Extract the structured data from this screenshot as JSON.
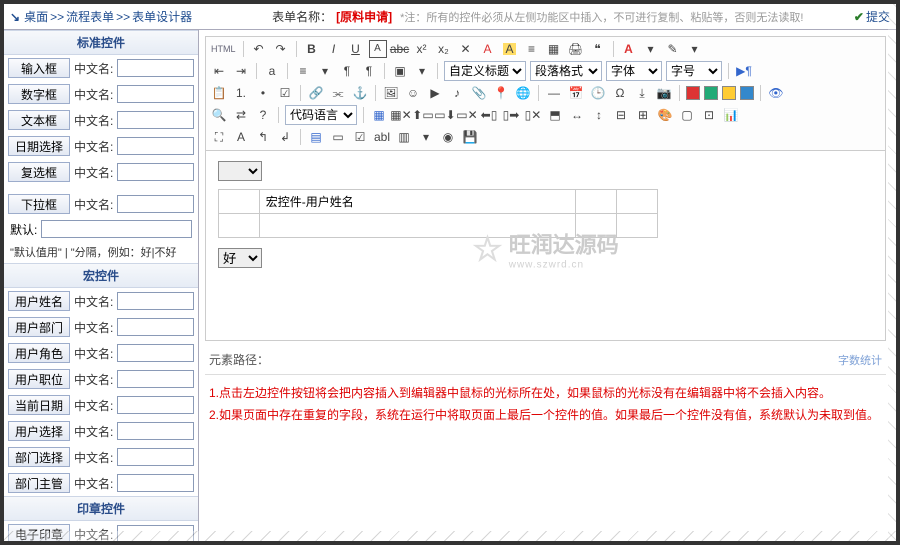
{
  "breadcrumb": {
    "icon": "↘",
    "p1": "桌面",
    "sep": ">>",
    "p2": "流程表单",
    "p3": "表单设计器"
  },
  "header": {
    "form_name_label": "表单名称：",
    "form_name_value": "[原料申请]",
    "note": "*注：所有的控件必须从左侧功能区中插入，不可进行复制、粘贴等，否则无法读取!",
    "submit": "提交"
  },
  "sidebar": {
    "std_header": "标准控件",
    "cn_label": "中文名:",
    "std_items": [
      {
        "btn": "输入框"
      },
      {
        "btn": "数字框"
      },
      {
        "btn": "文本框"
      },
      {
        "btn": "日期选择"
      },
      {
        "btn": "复选框"
      }
    ],
    "dropdown_btn": "下拉框",
    "default_label": "默认:",
    "default_hint": "\"默认值用\" | \"分隔，例如：好|不好",
    "macro_header": "宏控件",
    "macro_items": [
      {
        "btn": "用户姓名"
      },
      {
        "btn": "用户部门"
      },
      {
        "btn": "用户角色"
      },
      {
        "btn": "用户职位"
      },
      {
        "btn": "当前日期"
      },
      {
        "btn": "用户选择"
      },
      {
        "btn": "部门选择"
      },
      {
        "btn": "部门主管"
      }
    ],
    "seal_header": "印章控件",
    "seal_btn": "电子印章"
  },
  "toolbar": {
    "html_label": "HTML",
    "selects": {
      "custom_label": "自定义标题",
      "para_format": "段落格式",
      "font": "字体",
      "size": "字号",
      "code_lang": "代码语言"
    }
  },
  "editor": {
    "table_cell": "宏控件-用户姓名",
    "good_option": "好"
  },
  "watermark": {
    "text": "旺润达源码",
    "sub": "www.szwrd.cn"
  },
  "path": {
    "label": "元素路径：",
    "wordcount": "字数统计"
  },
  "notes": {
    "n1": "1.点击左边控件按钮将会把内容插入到编辑器中鼠标的光标所在处，如果鼠标的光标没有在编辑器中将不会插入内容。",
    "n2": "2.如果页面中存在重复的字段，系统在运行中将取页面上最后一个控件的值。如果最后一个控件没有值，系统默认为未取到值。"
  }
}
